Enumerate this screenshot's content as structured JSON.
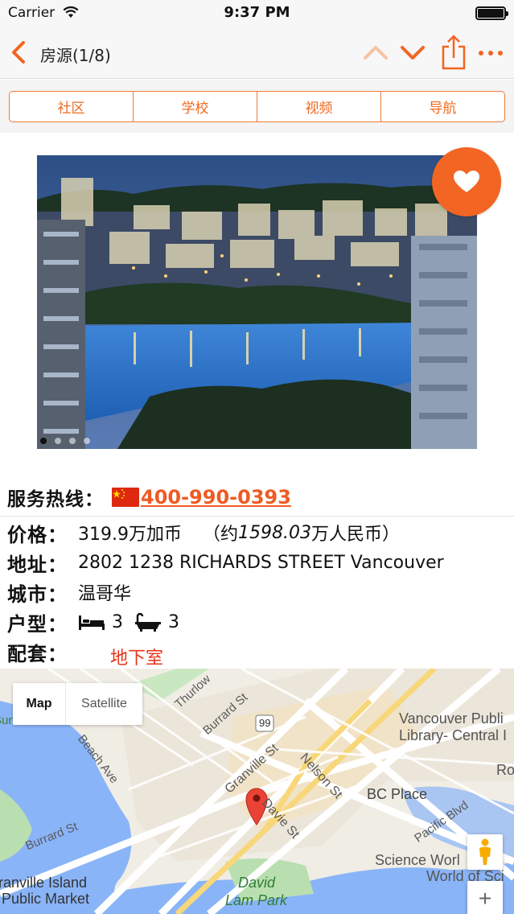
{
  "status_bar": {
    "carrier": "Carrier",
    "time": "9:37 PM",
    "battery_level": 1.0
  },
  "nav": {
    "title": "房源(1/8)",
    "icons": [
      "chevron-left-icon",
      "chevron-up-icon",
      "chevron-down-icon",
      "share-icon",
      "more-icon"
    ],
    "accent_color": "#f26522"
  },
  "tabs": [
    {
      "label": "社区"
    },
    {
      "label": "学校"
    },
    {
      "label": "视频"
    },
    {
      "label": "导航"
    }
  ],
  "gallery": {
    "current_index": 1,
    "total_dots": 4,
    "favorite_icon": "heart-icon"
  },
  "hotline": {
    "label": "服务热线：",
    "number": "400-990-0393",
    "flag_icon": "china-flag-icon"
  },
  "listing": {
    "price_label": "价格：",
    "price_value": "319.9万加币",
    "price_approx_prefix": "（约",
    "price_approx_value": "1598.03",
    "price_approx_suffix": "万人民币）",
    "address_label": "地址：",
    "address_value": "2802 1238 RICHARDS STREET Vancouver",
    "city_label": "城市：",
    "city_value": "温哥华",
    "layout_label": "户型：",
    "bedrooms": "3",
    "bathrooms": "3",
    "amenities_label": "配套：",
    "amenities": [
      "地下室"
    ]
  },
  "map": {
    "type_options": {
      "map": "Map",
      "satellite": "Satellite"
    },
    "selected_type": "Map",
    "zoom_in_label": "+",
    "labels": {
      "thurlow": "Thurlow",
      "burrard_st_top": "Burrard St",
      "highway": "99",
      "sunset_beach": "Sunset Beach Park",
      "beach_ave": "Beach Ave",
      "granville_st": "Granville St",
      "nelson_st": "Nelson St",
      "library_1": "Vancouver Publi",
      "library_2": "Library- Central I",
      "bc_place": "BC Place",
      "pacific_blvd": "Pacific Blvd",
      "davie_st": "Davie St",
      "burrard_st_bottom": "Burrard St",
      "granville_island_1": "ranville Island",
      "granville_island_2": "Public Market",
      "david_lam_1": "David",
      "david_lam_2": "Lam Park",
      "science_world_1": "Science Worl",
      "science_world_2": "World of Sci",
      "ro": "Ro"
    }
  }
}
